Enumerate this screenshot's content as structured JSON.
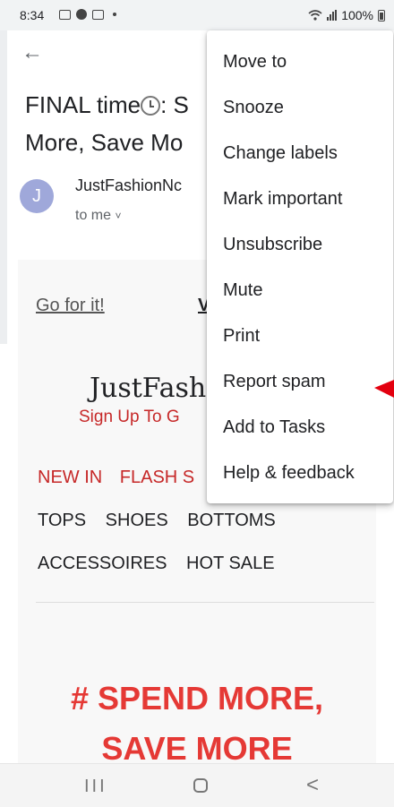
{
  "status_bar": {
    "time": "8:34",
    "battery": "100%",
    "icons": [
      "message-icon",
      "facebook-icon",
      "gallery-icon",
      "notification-dot-icon",
      "wifi-icon",
      "signal-icon",
      "battery-icon"
    ]
  },
  "email": {
    "subject_part1": "FINAL time",
    "subject_cut": ": S",
    "subject_line2": "More, Save Mo",
    "avatar_letter": "J",
    "sender": "JustFashionNc",
    "recipient": "to me",
    "recipient_chevron": "˅"
  },
  "body": {
    "go_link": "Go for it!",
    "view_link": "V",
    "logo": "JustFash",
    "signup": "Sign Up To G",
    "nav_primary": [
      "NEW IN",
      "FLASH S"
    ],
    "nav_secondary_row1": [
      "TOPS",
      "SHOES",
      "BOTTOMS"
    ],
    "nav_secondary_row2": [
      "ACCESSOIRES",
      "HOT SALE"
    ],
    "headline_line1": "# SPEND MORE,",
    "headline_line2": "SAVE MORE"
  },
  "menu": {
    "items": [
      "Move to",
      "Snooze",
      "Change labels",
      "Mark important",
      "Unsubscribe",
      "Mute",
      "Print",
      "Report spam",
      "Add to Tasks",
      "Help & feedback"
    ]
  },
  "annotation": {
    "arrow_color": "#e3000f"
  },
  "nav_bar": {
    "recents_symbol": "III",
    "back_symbol": "<"
  },
  "colors": {
    "accent_red": "#c62828",
    "headline_red": "#e53935",
    "avatar": "#9fa8da"
  }
}
